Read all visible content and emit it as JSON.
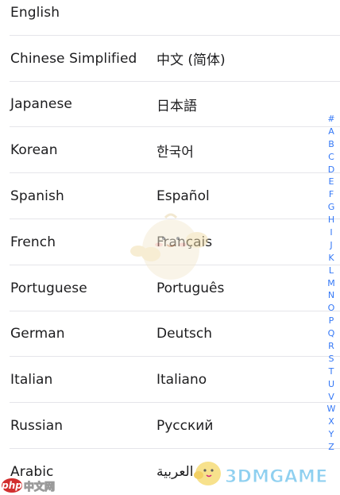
{
  "languages": [
    {
      "english": "English",
      "native": ""
    },
    {
      "english": "Chinese Simplified",
      "native": "中文 (简体)"
    },
    {
      "english": "Japanese",
      "native": "日本語"
    },
    {
      "english": "Korean",
      "native": "한국어"
    },
    {
      "english": "Spanish",
      "native": "Español"
    },
    {
      "english": "French",
      "native": "Français"
    },
    {
      "english": "Portuguese",
      "native": "Português"
    },
    {
      "english": "German",
      "native": "Deutsch"
    },
    {
      "english": "Italian",
      "native": "Italiano"
    },
    {
      "english": "Russian",
      "native": "Русский"
    },
    {
      "english": "Arabic",
      "native": "العربية"
    }
  ],
  "index_bar": {
    "letters": [
      "#",
      "A",
      "B",
      "C",
      "D",
      "E",
      "F",
      "G",
      "H",
      "I",
      "J",
      "K",
      "L",
      "M",
      "N",
      "O",
      "P",
      "Q",
      "R",
      "S",
      "T",
      "U",
      "V",
      "W",
      "X",
      "Y",
      "Z"
    ],
    "color": "#3478f6"
  },
  "watermarks": {
    "php_logo": "php",
    "php_text": "中文网",
    "site_text": "3DMGAME"
  },
  "colors": {
    "text": "#1c1c1e",
    "separator": "#e5e5ea",
    "background": "#ffffff"
  }
}
